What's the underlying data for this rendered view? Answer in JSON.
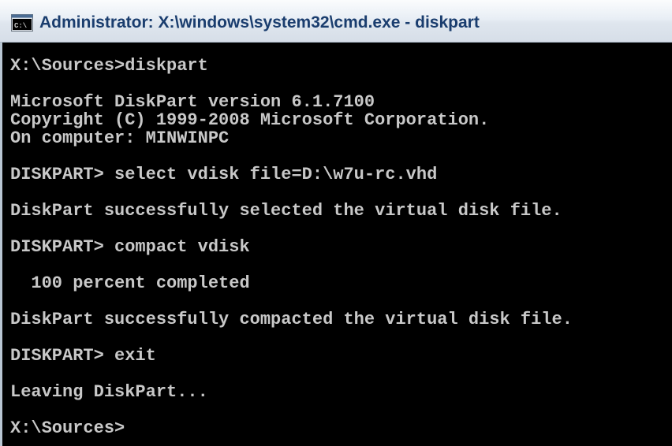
{
  "window": {
    "title": "Administrator: X:\\windows\\system32\\cmd.exe - diskpart",
    "icon": "cmd-console-icon"
  },
  "console": {
    "lines": [
      "X:\\Sources>diskpart",
      "",
      "Microsoft DiskPart version 6.1.7100",
      "Copyright (C) 1999-2008 Microsoft Corporation.",
      "On computer: MINWINPC",
      "",
      "DISKPART> select vdisk file=D:\\w7u-rc.vhd",
      "",
      "DiskPart successfully selected the virtual disk file.",
      "",
      "DISKPART> compact vdisk",
      "",
      "  100 percent completed",
      "",
      "DiskPart successfully compacted the virtual disk file.",
      "",
      "DISKPART> exit",
      "",
      "Leaving DiskPart...",
      "",
      "X:\\Sources>"
    ]
  },
  "colors": {
    "console_background": "#000000",
    "console_text": "#c8c8c8",
    "title_text": "#1a3d6e"
  }
}
